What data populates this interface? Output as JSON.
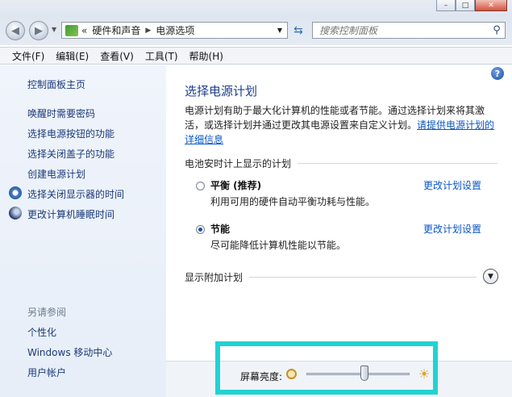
{
  "window": {
    "minimize_glyph": "–",
    "maximize_glyph": "□",
    "close_glyph": "✕"
  },
  "address": {
    "overflow": "«",
    "crumb1": "硬件和声音",
    "crumb2": "电源选项"
  },
  "search": {
    "placeholder": "搜索控制面板"
  },
  "menu": [
    "文件(F)",
    "编辑(E)",
    "查看(V)",
    "工具(T)",
    "帮助(H)"
  ],
  "sidebar": {
    "home": "控制面板主页",
    "links": [
      "唤醒时需要密码",
      "选择电源按钮的功能",
      "选择关闭盖子的功能",
      "创建电源计划",
      "选择关闭显示器的时间",
      "更改计算机睡眠时间"
    ],
    "see_also_title": "另请参阅",
    "see_also": [
      "个性化",
      "Windows 移动中心",
      "用户帐户"
    ]
  },
  "main": {
    "title": "选择电源计划",
    "desc_line1": "电源计划有助于最大化计算机的性能或者节能。通过选择计划来将其激",
    "desc_line2_text": "活，或选择计划并通过更改其电源设置来自定义计划。",
    "desc_link_a": "请提供电源计划的",
    "desc_link_b": "详细信息",
    "section_battery": "电池安时计上显示的计划",
    "plans": [
      {
        "name": "平衡 (推荐)",
        "desc": "利用可用的硬件自动平衡功耗与性能。",
        "selected": false,
        "link": "更改计划设置"
      },
      {
        "name": "节能",
        "desc": "尽可能降低计算机性能以节能。",
        "selected": true,
        "link": "更改计划设置"
      }
    ],
    "section_more": "显示附加计划"
  },
  "brightness": {
    "label": "屏幕亮度:",
    "level_percent": 56
  },
  "colors": {
    "highlight": "#21d3d3",
    "link": "#0a56c7",
    "title": "#1d3e8c"
  }
}
